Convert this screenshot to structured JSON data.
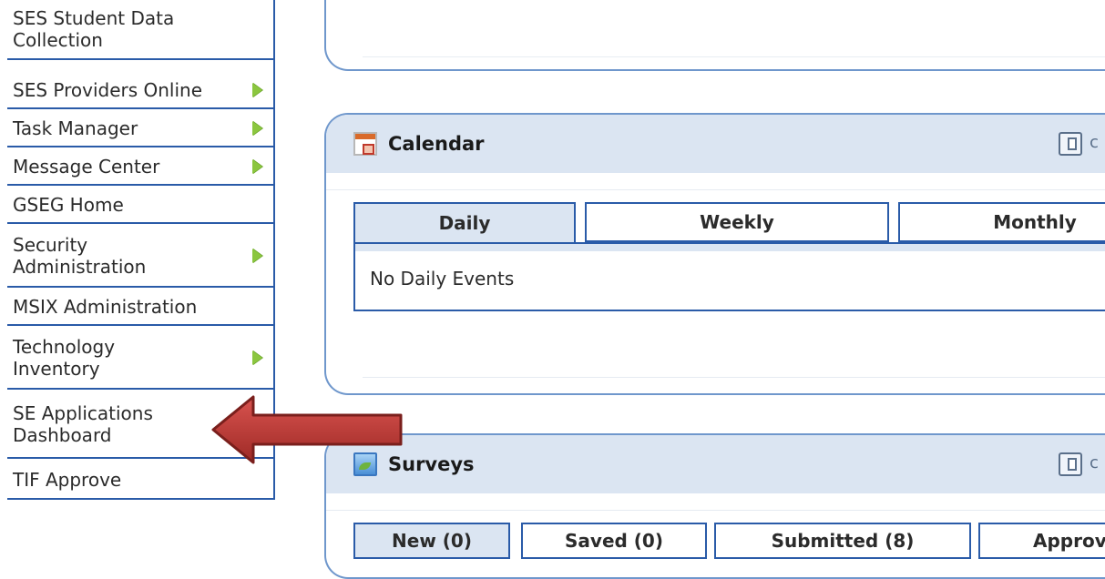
{
  "sidebar": {
    "items": [
      {
        "label": "SES Student Data Collection",
        "has_submenu": false
      },
      {
        "label": "SES Providers Online",
        "has_submenu": true
      },
      {
        "label": "Task Manager",
        "has_submenu": true
      },
      {
        "label": "Message Center",
        "has_submenu": true
      },
      {
        "label": "GSEG Home",
        "has_submenu": false
      },
      {
        "label": "Security Administration",
        "has_submenu": true
      },
      {
        "label": "MSIX Administration",
        "has_submenu": false
      },
      {
        "label": "Technology Inventory",
        "has_submenu": true
      },
      {
        "label": "SE Applications Dashboard",
        "has_submenu": false
      },
      {
        "label": "TIF Approve",
        "has_submenu": false
      }
    ]
  },
  "calendar": {
    "title": "Calendar",
    "tabs": [
      "Daily",
      "Weekly",
      "Monthly"
    ],
    "active_tab": "Daily",
    "empty_text": "No Daily Events"
  },
  "surveys": {
    "title": "Surveys",
    "tabs": [
      "New (0)",
      "Saved (0)",
      "Submitted (8)",
      "Approv"
    ],
    "active_tab": "New (0)"
  },
  "colors": {
    "nav_border": "#2a5ba8",
    "panel_border": "#6f97cc",
    "panel_header": "#dbe5f2",
    "submenu_arrow": "#8bc63f",
    "callout_arrow": "#c0392b"
  }
}
